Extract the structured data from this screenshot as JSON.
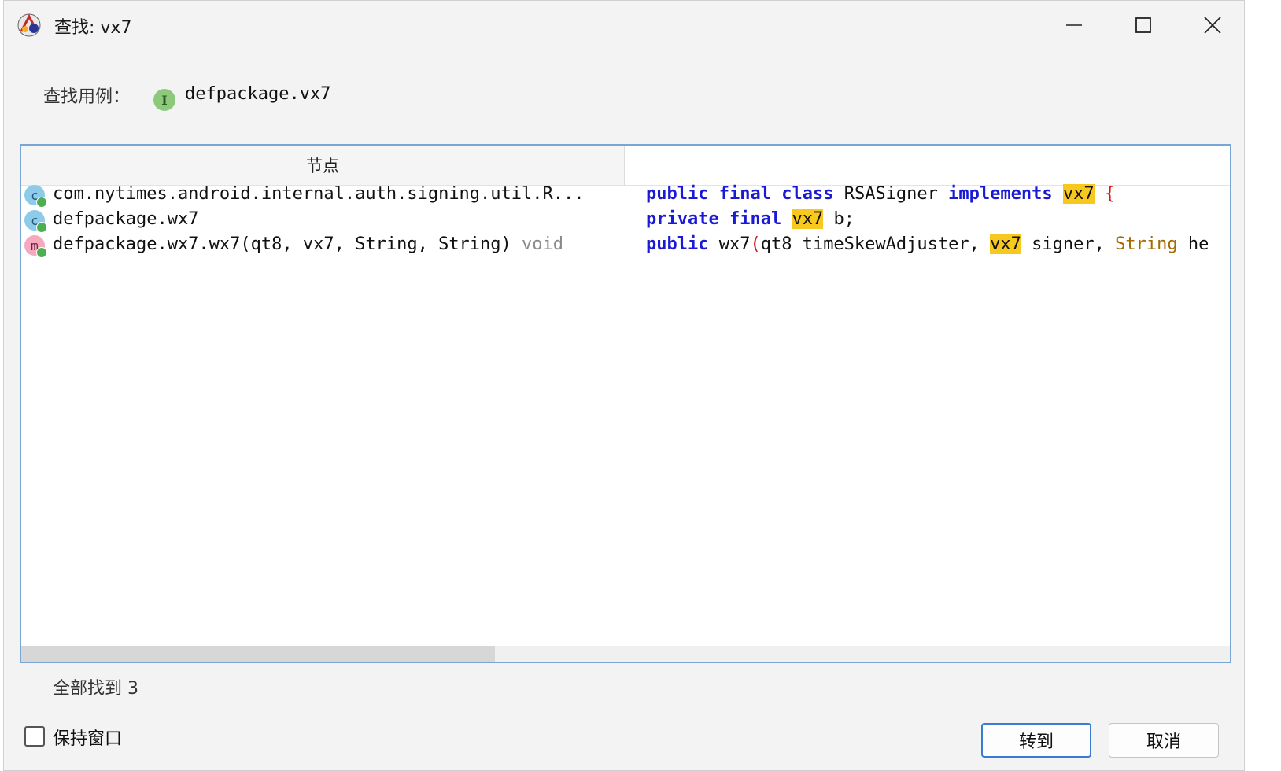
{
  "window": {
    "title": "查找: vx7"
  },
  "search": {
    "label": "查找用例：",
    "target_icon_letter": "I",
    "target": "defpackage.vx7"
  },
  "table": {
    "columns": [
      "节点",
      ""
    ],
    "rows": [
      {
        "icon": "class-icon",
        "icon_letter": "c",
        "node": "com.nytimes.android.internal.auth.signing.util.R...",
        "node_suffix": "",
        "code": [
          {
            "t": "public",
            "s": "kw"
          },
          {
            "t": " "
          },
          {
            "t": "final",
            "s": "kw"
          },
          {
            "t": " "
          },
          {
            "t": "class",
            "s": "kw"
          },
          {
            "t": " RSASigner "
          },
          {
            "t": "implements",
            "s": "kw"
          },
          {
            "t": " "
          },
          {
            "t": "vx7",
            "s": "hl"
          },
          {
            "t": " "
          },
          {
            "t": "{",
            "s": "brace"
          }
        ]
      },
      {
        "icon": "class-icon",
        "icon_letter": "c",
        "node": "defpackage.wx7",
        "node_suffix": "",
        "code": [
          {
            "t": "private",
            "s": "kw"
          },
          {
            "t": " "
          },
          {
            "t": "final",
            "s": "kw"
          },
          {
            "t": " "
          },
          {
            "t": "vx7",
            "s": "hl"
          },
          {
            "t": " b;"
          }
        ]
      },
      {
        "icon": "method-icon",
        "icon_letter": "m",
        "node": "defpackage.wx7.wx7(qt8, vx7, String, String)",
        "node_suffix": " void",
        "code": [
          {
            "t": "public",
            "s": "kw"
          },
          {
            "t": " wx7"
          },
          {
            "t": "(",
            "s": "brace"
          },
          {
            "t": "qt8 timeSkewAdjuster, "
          },
          {
            "t": "vx7",
            "s": "hl"
          },
          {
            "t": " signer, "
          },
          {
            "t": "String",
            "s": "type"
          },
          {
            "t": " he"
          }
        ]
      }
    ],
    "scrollbar_position": 0.0
  },
  "footer": {
    "found_label": "全部找到 3",
    "keep_window_label": "保持窗口",
    "keep_window_checked": false,
    "goto_label": "转到",
    "cancel_label": "取消"
  },
  "colors": {
    "accent": "#3b7bd0",
    "highlight": "#f7c81e",
    "keyword": "#1a1ad6",
    "status_dot": "#4caf50"
  }
}
